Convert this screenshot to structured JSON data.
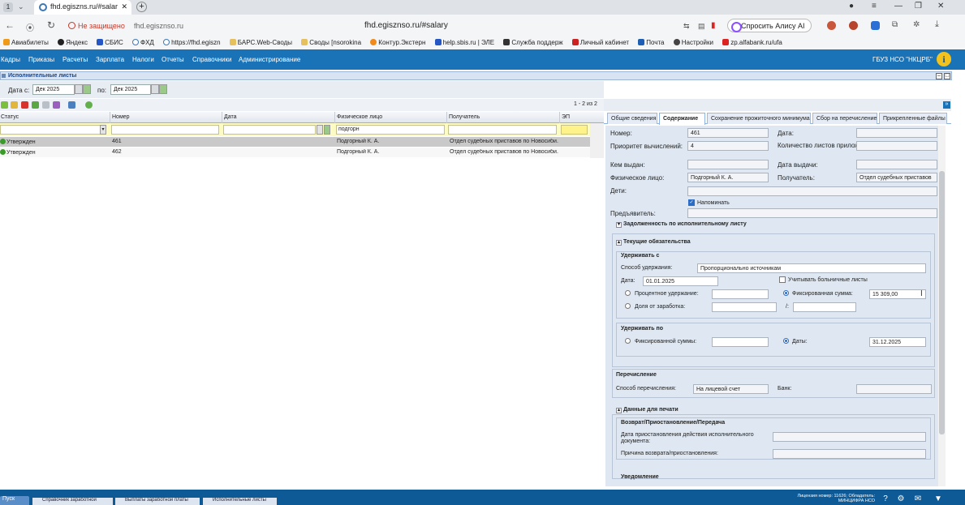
{
  "browser": {
    "tab_number": "1",
    "tab_title": "fhd.egiszns.ru/#salar",
    "security_label": "Не защищено",
    "host_label": "fhd.egisznso.ru",
    "url": "fhd.egisznso.ru/#salary",
    "alice_label": "Спросить Алису AI",
    "bookmarks": [
      "Авиабилеты",
      "Яндекс",
      "СБИС",
      "ФХД",
      "https://fhd.egiszn",
      "БАРС.Web-Своды",
      "Своды [nsorokina",
      "Контур.Экстерн",
      "help.sbis.ru | ЭЛЕ",
      "Служба поддерж",
      "Личный кабинет",
      "Почта",
      "Настройки",
      "zp.alfabank.ru/ufa"
    ]
  },
  "app": {
    "menu": [
      "Кадры",
      "Приказы",
      "Расчеты",
      "Зарплата",
      "Налоги",
      "Отчеты",
      "Справочники",
      "Администрирование"
    ],
    "org": "ГБУЗ НСО \"НКЦРБ\"",
    "panel_title": "Исполнительные листы"
  },
  "filter": {
    "date_from_label": "Дата с:",
    "date_from": "Дек 2025",
    "date_to_label": "по:",
    "date_to": "Дек 2025"
  },
  "grid": {
    "count": "1 - 2 из 2",
    "columns": [
      "Статус",
      "Номер",
      "Дата",
      "Физическое лицо",
      "Получатель",
      "ЭП"
    ],
    "filter_person": "подгорн",
    "rows": [
      {
        "status": "Утвержден",
        "number": "461",
        "date": "",
        "person": "Подгорный К. А.",
        "recipient": "Отдел судебных приставов по Новосиби..."
      },
      {
        "status": "Утвержден",
        "number": "462",
        "date": "",
        "person": "Подгорный К. А.",
        "recipient": "Отдел судебных приставов по Новосиби..."
      }
    ]
  },
  "detail": {
    "tabs": [
      "Общие сведения",
      "Содержание",
      "Сохранение прожиточного минимума",
      "Сбор на перечисление",
      "Прикрепленные файлы"
    ],
    "active_tab": "Содержание",
    "number_label": "Номер:",
    "number": "461",
    "date_label": "Дата:",
    "priority_label": "Приоритет вычислений:",
    "priority": "4",
    "attach_count_label": "Количество листов приложения:",
    "issued_by_label": "Кем выдан:",
    "issue_date_label": "Дата выдачи:",
    "person_label": "Физическое лицо:",
    "person": "Подгорный К. А.",
    "recipient_label": "Получатель:",
    "recipient": "Отдел судебных приставов",
    "children_label": "Дети:",
    "remind_label": "Напоминать",
    "presenter_label": "Предъявитель:",
    "debt_section": "Задолженность по исполнительному листу",
    "current_section": "Текущие обязательства",
    "withhold_from_title": "Удерживать с",
    "withhold_method_label": "Способ удержания:",
    "withhold_method": "Пропорционально источникам",
    "sick_leave_label": "Учитывать больничные листы",
    "from_date_label": "Дата:",
    "from_date": "01.01.2025",
    "percent_label": "Процентное удержание:",
    "fixed_sum_label": "Фиксированная сумма:",
    "fixed_sum": "15 309,00",
    "share_label": "Доля от заработка:",
    "share_sep": "/:",
    "withhold_until_title": "Удерживать по",
    "until_fixed_label": "Фиксированной суммы:",
    "until_date_label": "Даты:",
    "until_date": "31.12.2025",
    "transfer_title": "Перечисление",
    "transfer_method_label": "Способ перечисления:",
    "transfer_method": "На лицевой счет",
    "bank_label": "Банк:",
    "print_section": "Данные для печати",
    "return_title": "Возврат/Приостановление/Передача",
    "suspend_date_label": "Дата приостановления действия исполнительного документа:",
    "return_reason_label": "Причина возврата/приостановления:",
    "notice_title": "Уведомление"
  },
  "taskbar": {
    "start": "Пуск",
    "tasks": [
      "Справочник заработной",
      "Выплаты заработной платы",
      "Исполнительные листы"
    ],
    "license": "Лицензия номер: 11626; Обладатель: МИНЦИФРА НСО"
  }
}
